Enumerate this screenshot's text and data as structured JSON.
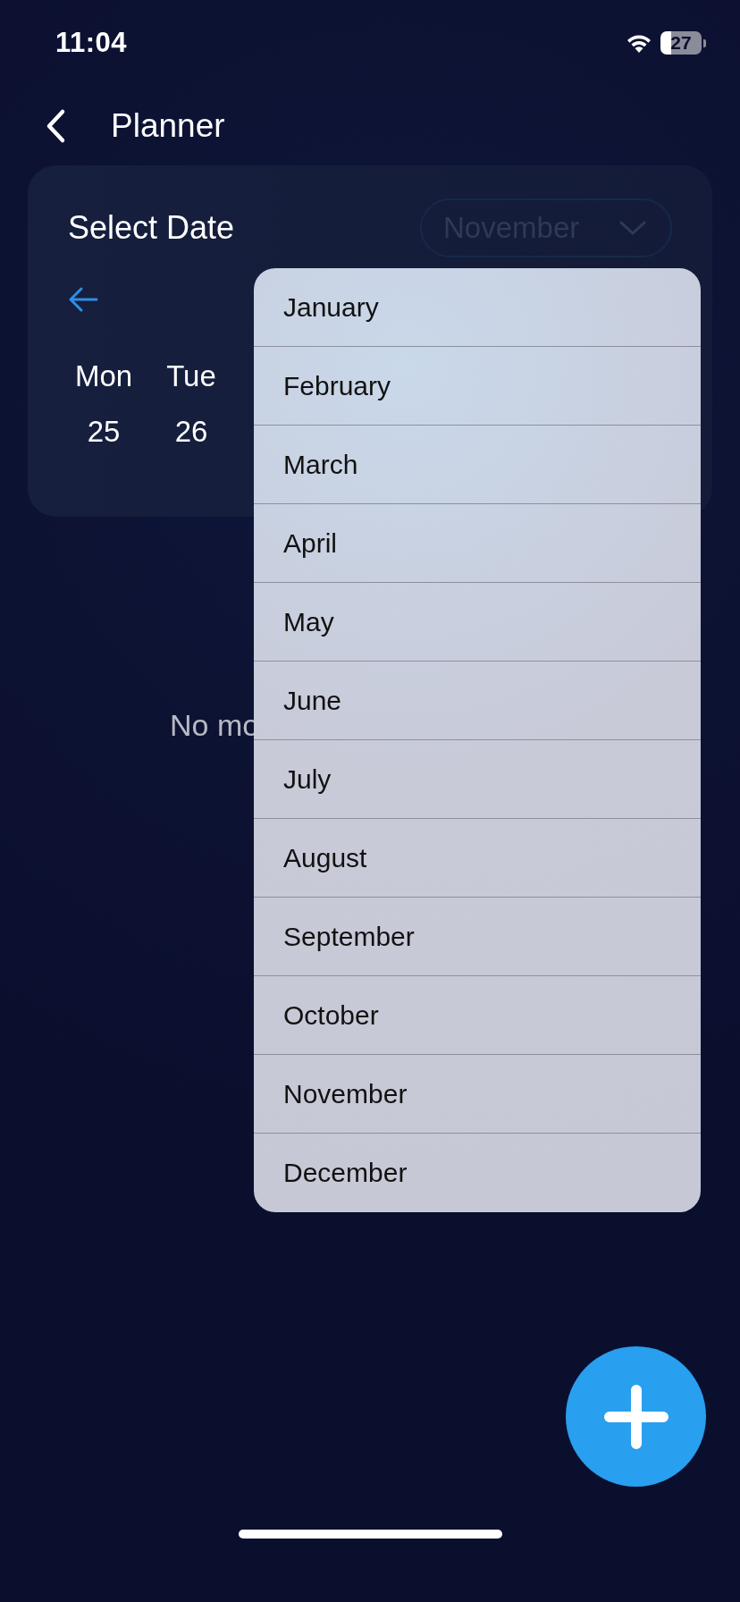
{
  "status_bar": {
    "time": "11:04",
    "battery": "27"
  },
  "header": {
    "title": "Planner"
  },
  "date_card": {
    "title": "Select Date",
    "month_picker": {
      "value": "November"
    },
    "days": [
      {
        "weekday": "Mon",
        "date": "25"
      },
      {
        "weekday": "Tue",
        "date": "26"
      }
    ]
  },
  "empty_message": "No mo",
  "month_menu": {
    "items": [
      {
        "label": "January",
        "selected": false
      },
      {
        "label": "February",
        "selected": false
      },
      {
        "label": "March",
        "selected": false
      },
      {
        "label": "April",
        "selected": false
      },
      {
        "label": "May",
        "selected": false
      },
      {
        "label": "June",
        "selected": false
      },
      {
        "label": "July",
        "selected": false
      },
      {
        "label": "August",
        "selected": false
      },
      {
        "label": "September",
        "selected": false
      },
      {
        "label": "October",
        "selected": false
      },
      {
        "label": "November",
        "selected": false
      },
      {
        "label": "December",
        "selected": false
      }
    ]
  }
}
